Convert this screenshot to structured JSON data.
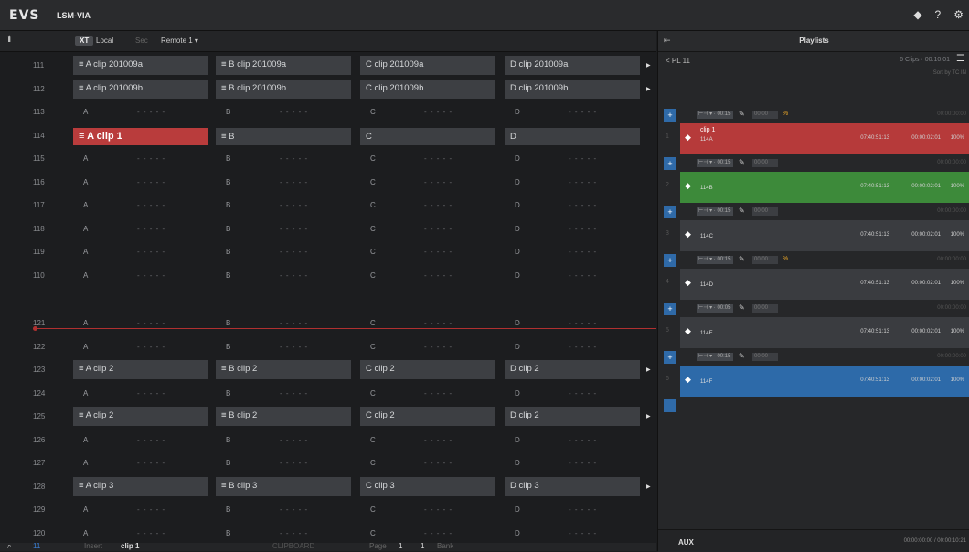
{
  "app": {
    "logo": "EVS",
    "name": "LSM-VIA"
  },
  "top_icons": [
    "badge-icon",
    "help-icon",
    "settings-icon"
  ],
  "top_icon_glyphs": [
    "◆",
    "?",
    "⚙"
  ],
  "left": {
    "header": {
      "pill": "XT",
      "local": "Local",
      "sec": "Sec",
      "remote": "Remote 1 ▾",
      "dot": "⬆"
    },
    "rows_top": [
      {
        "num": "111",
        "cells": [
          "≡ A clip 201009a",
          "≡ B clip 201009a",
          "C clip 201009a",
          "D clip 201009a"
        ],
        "marker": true,
        "kind": "clip"
      },
      {
        "num": "112",
        "cells": [
          "≡ A clip 201009b",
          "≡ B clip 201009b",
          "C clip 201009b",
          "D clip 201009b"
        ],
        "marker": true,
        "kind": "clip"
      },
      {
        "num": "113",
        "cells": [
          "A",
          "B",
          "C",
          "D"
        ],
        "kind": "empty"
      },
      {
        "num": "114",
        "cells": [
          "≡ A clip 1",
          "≡ B",
          "C",
          "D"
        ],
        "kind": "clip114"
      },
      {
        "num": "115",
        "cells": [
          "A",
          "B",
          "C",
          "D"
        ],
        "kind": "empty"
      },
      {
        "num": "116",
        "cells": [
          "A",
          "B",
          "C",
          "D"
        ],
        "kind": "empty"
      },
      {
        "num": "117",
        "cells": [
          "A",
          "B",
          "C",
          "D"
        ],
        "kind": "empty"
      },
      {
        "num": "118",
        "cells": [
          "A",
          "B",
          "C",
          "D"
        ],
        "kind": "empty"
      },
      {
        "num": "119",
        "cells": [
          "A",
          "B",
          "C",
          "D"
        ],
        "kind": "empty"
      },
      {
        "num": "110",
        "cells": [
          "A",
          "B",
          "C",
          "D"
        ],
        "kind": "empty"
      }
    ],
    "rows_bottom": [
      {
        "num": "121",
        "cells": [
          "A",
          "B",
          "C",
          "D"
        ],
        "kind": "empty"
      },
      {
        "num": "122",
        "cells": [
          "A",
          "B",
          "C",
          "D"
        ],
        "kind": "empty"
      },
      {
        "num": "123",
        "cells": [
          "≡ A clip 2",
          "≡ B clip 2",
          "C clip 2",
          "D clip 2"
        ],
        "marker": true,
        "kind": "clip"
      },
      {
        "num": "124",
        "cells": [
          "A",
          "B",
          "C",
          "D"
        ],
        "kind": "empty"
      },
      {
        "num": "125",
        "cells": [
          "≡ A clip 2",
          "≡ B clip 2",
          "C clip 2",
          "D clip 2"
        ],
        "marker": true,
        "kind": "clip"
      },
      {
        "num": "126",
        "cells": [
          "A",
          "B",
          "C",
          "D"
        ],
        "kind": "empty"
      },
      {
        "num": "127",
        "cells": [
          "A",
          "B",
          "C",
          "D"
        ],
        "kind": "empty"
      },
      {
        "num": "128",
        "cells": [
          "≡ A clip 3",
          "≡ B clip 3",
          "C clip 3",
          "D clip 3"
        ],
        "marker": true,
        "kind": "clip"
      },
      {
        "num": "129",
        "cells": [
          "A",
          "B",
          "C",
          "D"
        ],
        "kind": "empty"
      },
      {
        "num": "120",
        "cells": [
          "A",
          "B",
          "C",
          "D"
        ],
        "kind": "empty"
      }
    ],
    "dash": "- - - - -",
    "footer": {
      "search": "⌕",
      "page": "11",
      "mode": "Insert",
      "clip": "clip 1",
      "status": "CLIPBOARD",
      "page_label": "Page",
      "page_from": "1",
      "page_to": "1",
      "bank": "Bank"
    }
  },
  "right": {
    "title": "Playlists",
    "pin": "⇤",
    "pl": "< PL 11",
    "info": "6 Clips · 00:10:01",
    "sortby": "Sort by TC IN",
    "transitions": [
      {
        "plus": "+",
        "box": "⊢⊣ ▾ · 00:15",
        "box2": "00:00",
        "spd": "%",
        "tc": "00:00:00:00"
      },
      {
        "plus": "+",
        "box": "⊢⊣ ▾ · 00:15",
        "box2": "00:00",
        "spd": "",
        "tc": "00:00:00:00"
      },
      {
        "plus": "+",
        "box": "⊢⊣ ▾ · 00:15",
        "box2": "00:00",
        "spd": "",
        "tc": "00:00:00:00"
      },
      {
        "plus": "+",
        "box": "⊢⊣ ▾ · 00:15",
        "box2": "00:00",
        "spd": "%",
        "tc": "00:00:00:00"
      },
      {
        "plus": "+",
        "box": "⊢⊣ ▾ · 00:05",
        "box2": "00:00",
        "spd": "",
        "tc": "00:00:00:00"
      },
      {
        "plus": "+",
        "box": "⊢⊣ ▾ · 00:15",
        "box2": "00:00",
        "spd": "",
        "tc": "00:00:00:00"
      }
    ],
    "items": [
      {
        "num": "1",
        "label": "clip 1",
        "sub": "114A",
        "tcin": "07:40:51:13",
        "dur": "00:00:02:01",
        "pct": "100%",
        "color": "#b63a3a"
      },
      {
        "num": "2",
        "label": "",
        "sub": "114B",
        "tcin": "07:40:51:13",
        "dur": "00:00:02:01",
        "pct": "100%",
        "color": "#3d8a3a"
      },
      {
        "num": "3",
        "label": "",
        "sub": "114C",
        "tcin": "07:40:51:13",
        "dur": "00:00:02:01",
        "pct": "100%",
        "color": "#3a3c40"
      },
      {
        "num": "4",
        "label": "",
        "sub": "114D",
        "tcin": "07:40:51:13",
        "dur": "00:00:02:01",
        "pct": "100%",
        "color": "#3a3c40"
      },
      {
        "num": "5",
        "label": "",
        "sub": "114E",
        "tcin": "07:40:51:13",
        "dur": "00:00:02:01",
        "pct": "100%",
        "color": "#3a3c40"
      },
      {
        "num": "6",
        "label": "",
        "sub": "114F",
        "tcin": "07:40:51:13",
        "dur": "00:00:02:01",
        "pct": "100%",
        "color": "#2d6aa9"
      }
    ],
    "aux": {
      "label": "AUX",
      "time": "00:00:00:00 / 00:00:10:21"
    }
  }
}
